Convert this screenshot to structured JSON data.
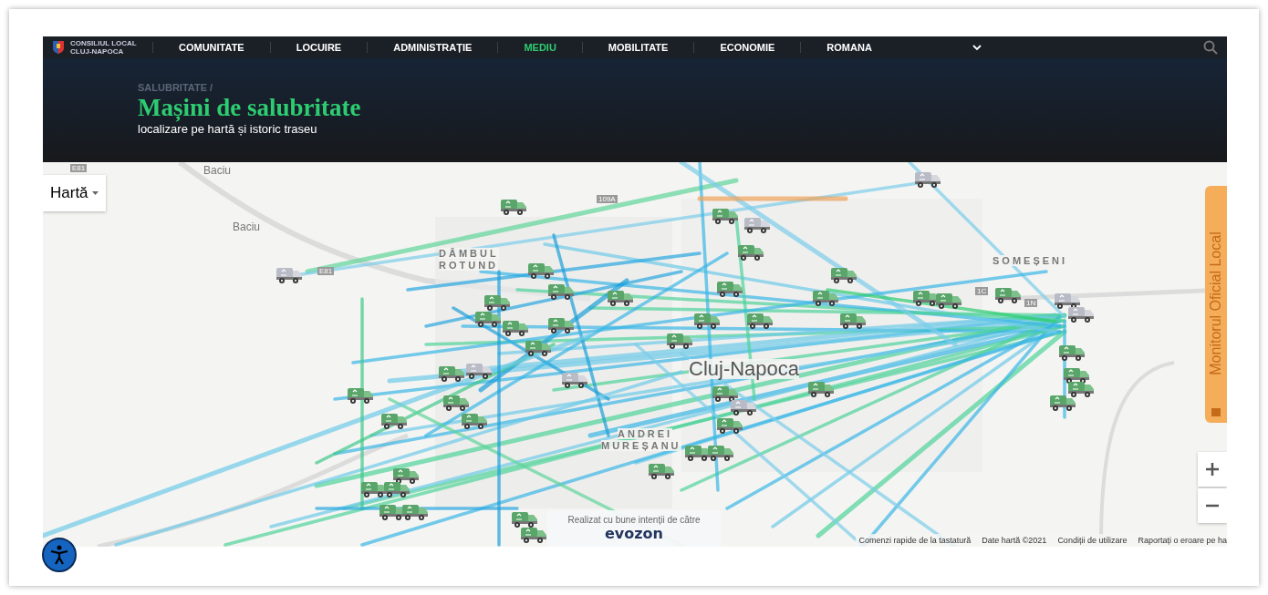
{
  "nav": {
    "logo_lines": [
      "CONSILIUL LOCAL",
      "CLUJ-NAPOCA"
    ],
    "items": [
      {
        "label": "COMUNITATE",
        "selected": false
      },
      {
        "label": "LOCUIRE",
        "selected": false
      },
      {
        "label": "ADMINISTRAȚIE",
        "selected": false
      },
      {
        "label": "MEDIU",
        "selected": true
      },
      {
        "label": "MOBILITATE",
        "selected": false
      },
      {
        "label": "ECONOMIE",
        "selected": false
      }
    ],
    "language": "ROMANA"
  },
  "header": {
    "breadcrumb": "SALUBRITATE /",
    "title": "Mașini de salubritate",
    "subtitle": "localizare pe hartă și istoric traseu"
  },
  "map": {
    "type_control": "Hartă",
    "places": [
      {
        "label": "Baciu",
        "kind": "town"
      },
      {
        "label": "Baciu",
        "kind": "town"
      },
      {
        "label": "DÂMBUL",
        "kind": "district"
      },
      {
        "label": "ROTUND",
        "kind": "district"
      },
      {
        "label": "SOMEȘENI",
        "kind": "district"
      },
      {
        "label": "Cluj-Napoca",
        "kind": "city"
      },
      {
        "label": "ANDREI",
        "kind": "district"
      },
      {
        "label": "MUREȘANU",
        "kind": "district"
      },
      {
        "label": "E81",
        "kind": "road"
      },
      {
        "label": "E81",
        "kind": "road"
      },
      {
        "label": "1C",
        "kind": "road"
      },
      {
        "label": "1N",
        "kind": "road"
      },
      {
        "label": "109A",
        "kind": "road"
      }
    ],
    "side_tab": "Monitorul Oficial Local",
    "credit": {
      "text": "Realizat cu bune intenții de către",
      "logo": "evozon"
    },
    "footer_links": [
      "Comenzi rapide de la tastatură",
      "Date hartă ©2021",
      "Condiții de utilizare",
      "Raportați o eroare pe ha"
    ]
  }
}
